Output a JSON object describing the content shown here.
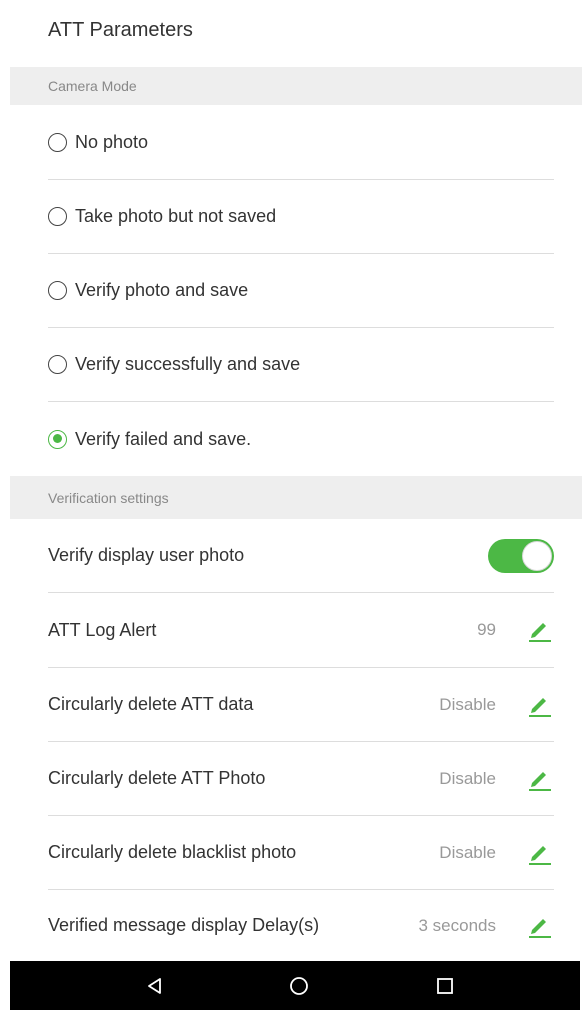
{
  "header": {
    "title": "ATT Parameters"
  },
  "camera_mode": {
    "section_label": "Camera Mode",
    "options": [
      {
        "label": "No photo",
        "checked": false
      },
      {
        "label": "Take photo but not saved",
        "checked": false
      },
      {
        "label": "Verify photo and save",
        "checked": false
      },
      {
        "label": "Verify successfully and save",
        "checked": false
      },
      {
        "label": "Verify failed and save.",
        "checked": true
      }
    ]
  },
  "verification": {
    "section_label": "Verification settings",
    "display_user_photo": {
      "label": "Verify display user photo",
      "enabled": true
    },
    "items": [
      {
        "label": "ATT Log Alert",
        "value": "99"
      },
      {
        "label": "Circularly delete ATT data",
        "value": "Disable"
      },
      {
        "label": "Circularly delete ATT Photo",
        "value": "Disable"
      },
      {
        "label": "Circularly delete blacklist photo",
        "value": "Disable"
      },
      {
        "label": "Verified message display Delay(s)",
        "value": "3 seconds"
      }
    ]
  },
  "nav_bar": {
    "buttons": [
      "back",
      "home",
      "recents"
    ]
  },
  "colors": {
    "accent": "#4cb845",
    "section_bg": "#eeeeee",
    "nav_bg": "#000000"
  }
}
